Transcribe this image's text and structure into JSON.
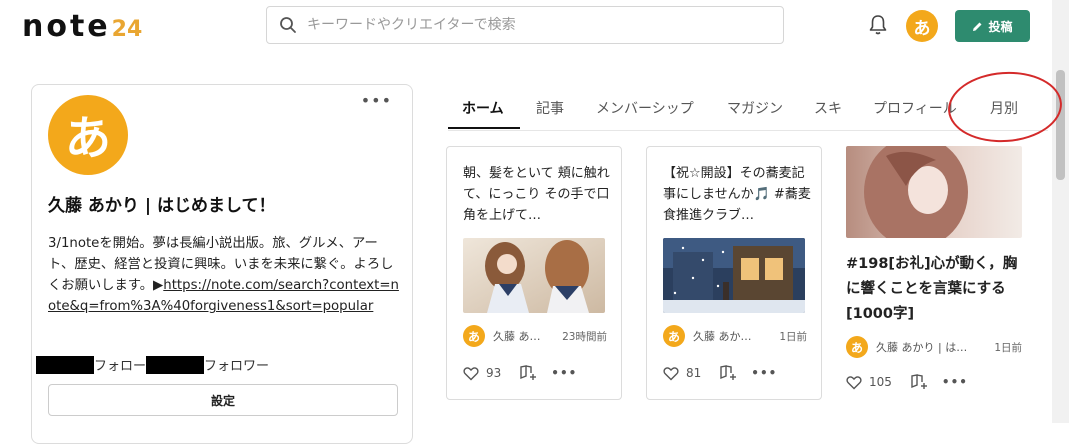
{
  "header": {
    "logo_text": "note",
    "logo_badge": "24",
    "search_placeholder": "キーワードやクリエイターで検索",
    "avatar_char": "あ",
    "post_label": "投稿"
  },
  "profile": {
    "avatar_char": "あ",
    "menu": "•••",
    "name": "久藤 あかり | はじめまして！",
    "bio_text": "3/1noteを開始。夢は長編小説出版。旅、グルメ、アート、歴史、経営と投資に興味。いまを未来に繋ぐ。よろしくお願いします。▶",
    "bio_link": "https://note.com/search?context=note&q=from%3A%40forgiveness1&sort=popular",
    "follow_label": "フォロー",
    "follower_label": "フォロワー",
    "settings_label": "設定"
  },
  "tabs": [
    {
      "label": "ホーム"
    },
    {
      "label": "記事"
    },
    {
      "label": "メンバーシップ"
    },
    {
      "label": "マガジン"
    },
    {
      "label": "スキ"
    },
    {
      "label": "プロフィール"
    },
    {
      "label": "月別"
    }
  ],
  "cards": [
    {
      "title": "朝、髪をといて 頬に触れて、にっこり その手で口角を上げて…",
      "author": "久藤 あ…",
      "time": "23時間前",
      "likes": "93"
    },
    {
      "title": "【祝☆開設】その蕎麦記事にしませんか🎵 #蕎麦食推進クラブ…",
      "author": "久藤 あか…",
      "time": "1日前",
      "likes": "81"
    }
  ],
  "featured": {
    "title": "#198[お礼]心が動く，胸に響くことを言葉にする[1000字]",
    "author": "久藤 あかり | は…",
    "time": "1日前",
    "likes": "105"
  },
  "colors": {
    "brand_green": "#2e8b6f",
    "avatar_orange": "#f3a81b",
    "annotation_red": "#d42a2a"
  },
  "icons": [
    "search-icon",
    "bell-icon",
    "pencil-icon",
    "heart-icon",
    "magazine-add-icon",
    "more-icon"
  ]
}
